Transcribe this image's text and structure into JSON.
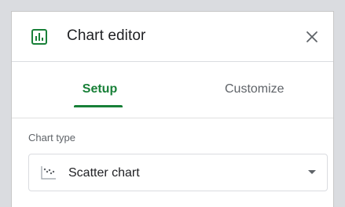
{
  "header": {
    "title": "Chart editor",
    "icon": "chart-editor-icon",
    "close_icon": "close-icon",
    "accent_color": "#188038"
  },
  "tabs": [
    {
      "label": "Setup",
      "active": true
    },
    {
      "label": "Customize",
      "active": false
    }
  ],
  "setup": {
    "chart_type_label": "Chart type",
    "chart_type_value": "Scatter chart",
    "chart_type_icon": "scatter-chart-icon"
  }
}
